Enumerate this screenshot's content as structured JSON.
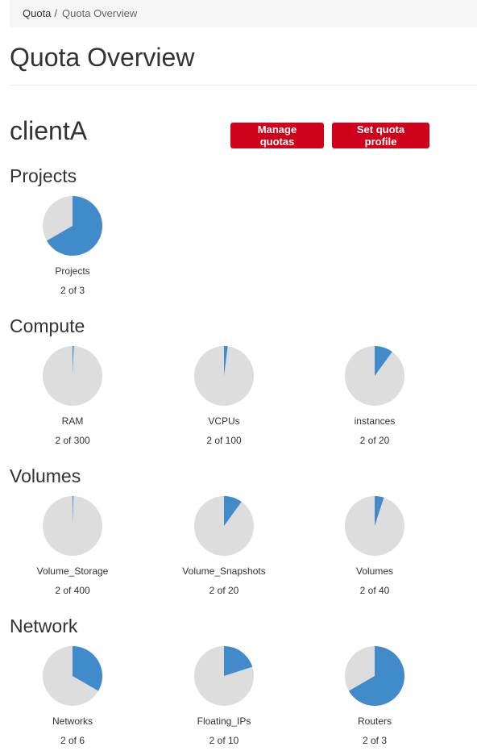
{
  "breadcrumb": {
    "items": [
      {
        "label": "Quota"
      },
      {
        "label": "Quota Overview"
      }
    ],
    "separator": "/"
  },
  "page": {
    "title": "Quota Overview",
    "client_name": "clientA"
  },
  "actions": {
    "manage_quotas": "Manage quotas",
    "set_quota_profile": "Set quota profile"
  },
  "colors": {
    "used": "#428bca",
    "free": "#dddddd",
    "button": "#d0021b"
  },
  "sections": [
    {
      "title": "Projects",
      "items": [
        {
          "label": "Projects",
          "used": 2,
          "total": 3,
          "text": "2 of 3"
        }
      ]
    },
    {
      "title": "Compute",
      "items": [
        {
          "label": "RAM",
          "used": 2,
          "total": 300,
          "text": "2 of 300"
        },
        {
          "label": "VCPUs",
          "used": 2,
          "total": 100,
          "text": "2 of 100"
        },
        {
          "label": "instances",
          "used": 2,
          "total": 20,
          "text": "2 of 20"
        }
      ]
    },
    {
      "title": "Volumes",
      "items": [
        {
          "label": "Volume_Storage",
          "used": 2,
          "total": 400,
          "text": "2 of 400"
        },
        {
          "label": "Volume_Snapshots",
          "used": 2,
          "total": 20,
          "text": "2 of 20"
        },
        {
          "label": "Volumes",
          "used": 2,
          "total": 40,
          "text": "2 of 40"
        }
      ]
    },
    {
      "title": "Network",
      "items": [
        {
          "label": "Networks",
          "used": 2,
          "total": 6,
          "text": "2 of 6"
        },
        {
          "label": "Floating_IPs",
          "used": 2,
          "total": 10,
          "text": "2 of 10"
        },
        {
          "label": "Routers",
          "used": 2,
          "total": 3,
          "text": "2 of 3"
        }
      ]
    }
  ]
}
